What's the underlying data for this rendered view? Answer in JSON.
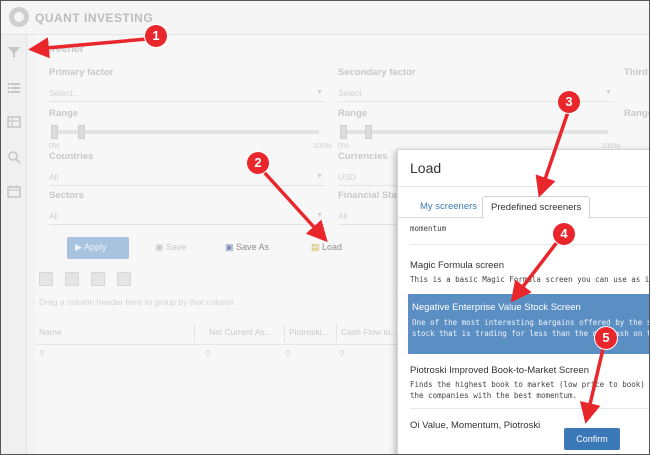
{
  "app": {
    "logo_text": "QUANT INVESTING"
  },
  "sidebar": {
    "items": [
      "filter-icon",
      "list-icon",
      "table-icon",
      "search-icon",
      "calendar-icon"
    ]
  },
  "screener": {
    "title": "Screener",
    "primary_factor": {
      "label": "Primary factor",
      "placeholder": "Select..."
    },
    "secondary_factor": {
      "label": "Secondary factor",
      "placeholder": "Select"
    },
    "third_factor": {
      "label": "Third"
    },
    "range_label": "Range",
    "range_min": "0%",
    "range_max": "100%",
    "countries": {
      "label": "Countries",
      "value": "All"
    },
    "currencies": {
      "label": "Currencies",
      "value": "USD"
    },
    "sectors": {
      "label": "Sectors",
      "value": "All"
    },
    "financial_statements": {
      "label": "Financial Stateme",
      "value": "All"
    }
  },
  "toolbar": {
    "apply": "Apply",
    "save": "Save",
    "save_as": "Save As",
    "load": "Load"
  },
  "grid": {
    "group_hint": "Drag a column header here to group by that column",
    "columns": [
      "Name",
      "Net Current As...",
      "Piotroski...",
      "Cash Flow to..."
    ]
  },
  "modal": {
    "title": "Load",
    "tabs": {
      "my": "My screeners",
      "predefined": "Predefined screeners"
    },
    "items": [
      {
        "title": "",
        "desc": "momentum"
      },
      {
        "title": "Magic Formula screen",
        "desc": "This is a basic Magic Formula screen you can use as is or to add any add"
      },
      {
        "title": "Negative Enterprise Value Stock Screen",
        "desc": "One of the most interesting bargains offered by the stock market is the",
        "desc2": "stock that is trading for less than the net cash on the company's balanc"
      },
      {
        "title": "Piotroski Improved Book-to-Market Screen",
        "desc": "Finds the highest book to market (low price to book) stocks with the be",
        "desc2": "the companies with the best momentum."
      },
      {
        "title": "Oi Value, Momentum, Piotroski",
        "desc": ""
      }
    ],
    "confirm": "Confirm"
  },
  "annotations": {
    "color": "#e8262b",
    "badges": [
      "1",
      "2",
      "3",
      "4",
      "5"
    ]
  }
}
